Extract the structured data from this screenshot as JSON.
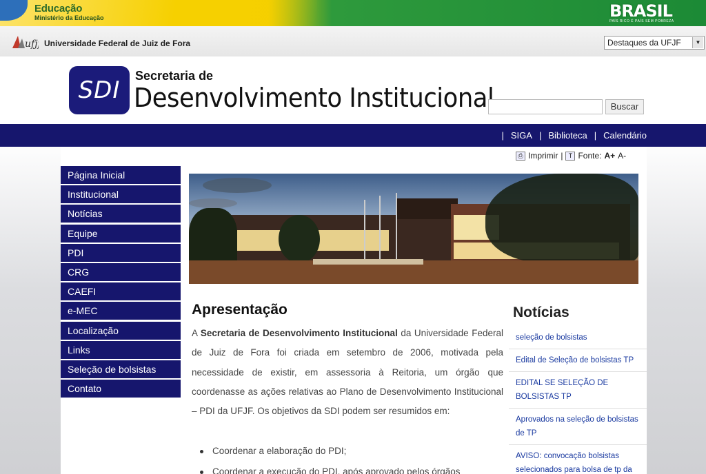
{
  "gov_bar": {
    "education": "Educação",
    "ministry": "Ministério da Educação",
    "brasil": "BRASIL",
    "brasil_slogan": "PAÍS RICO É PAÍS SEM POBREZA"
  },
  "ufjf_bar": {
    "logo": "ufjf",
    "university": "Universidade Federal de Juiz de Fora",
    "highlights_select": "Destaques da UFJF"
  },
  "header": {
    "badge": "SDI",
    "secretaria_de": "Secretaria de",
    "title": "Desenvolvimento Institucional",
    "search_button": "Buscar",
    "search_placeholder": ""
  },
  "topnav": {
    "links": [
      "SIGA",
      "Biblioteca",
      "Calendário"
    ]
  },
  "tools": {
    "print": "Imprimir",
    "font": "Fonte:",
    "font_up": "A+",
    "font_down": "A-"
  },
  "sidebar": {
    "items": [
      "Página Inicial",
      "Institucional",
      "Notícias",
      "Equipe",
      "PDI",
      "CRG",
      "CAEFI",
      "e-MEC",
      "Localização",
      "Links",
      "Seleção de bolsistas",
      "Contato"
    ]
  },
  "article": {
    "title": "Apresentação",
    "p_start": "A ",
    "p_bold": "Secretaria de Desenvolvimento Institucional",
    "p_rest": " da Universidade Federal de Juiz de Fora foi criada em setembro de 2006, motivada pela necessidade de existir, em assessoria à Reitoria, um órgão que coordenasse as ações relativas ao Plano de Desenvolvimento Institucional – PDI da UFJF. Os objetivos da SDI podem ser resumidos em:",
    "bullets": [
      "Coordenar a elaboração do PDI;",
      "Coordenar a execução do PDI, após aprovado pelos órgãos"
    ]
  },
  "news": {
    "title": "Notícias",
    "items": [
      "seleção de bolsistas",
      "Edital de Seleção de bolsistas TP",
      "EDITAL SE SELEÇÃO DE BOLSISTAS TP",
      "Aprovados na seleção de bolsistas de TP",
      "AVISO: convocação bolsistas selecionados para bolsa de tp da"
    ]
  },
  "colors": {
    "navy": "#16166d",
    "link_blue": "#1a3aa0",
    "gov_yellow": "#f6d000",
    "gov_green": "#1c8a36"
  },
  "icons": [
    "printer-icon",
    "font-icon",
    "dropdown-arrow-icon",
    "ufjf-logo-icon"
  ]
}
